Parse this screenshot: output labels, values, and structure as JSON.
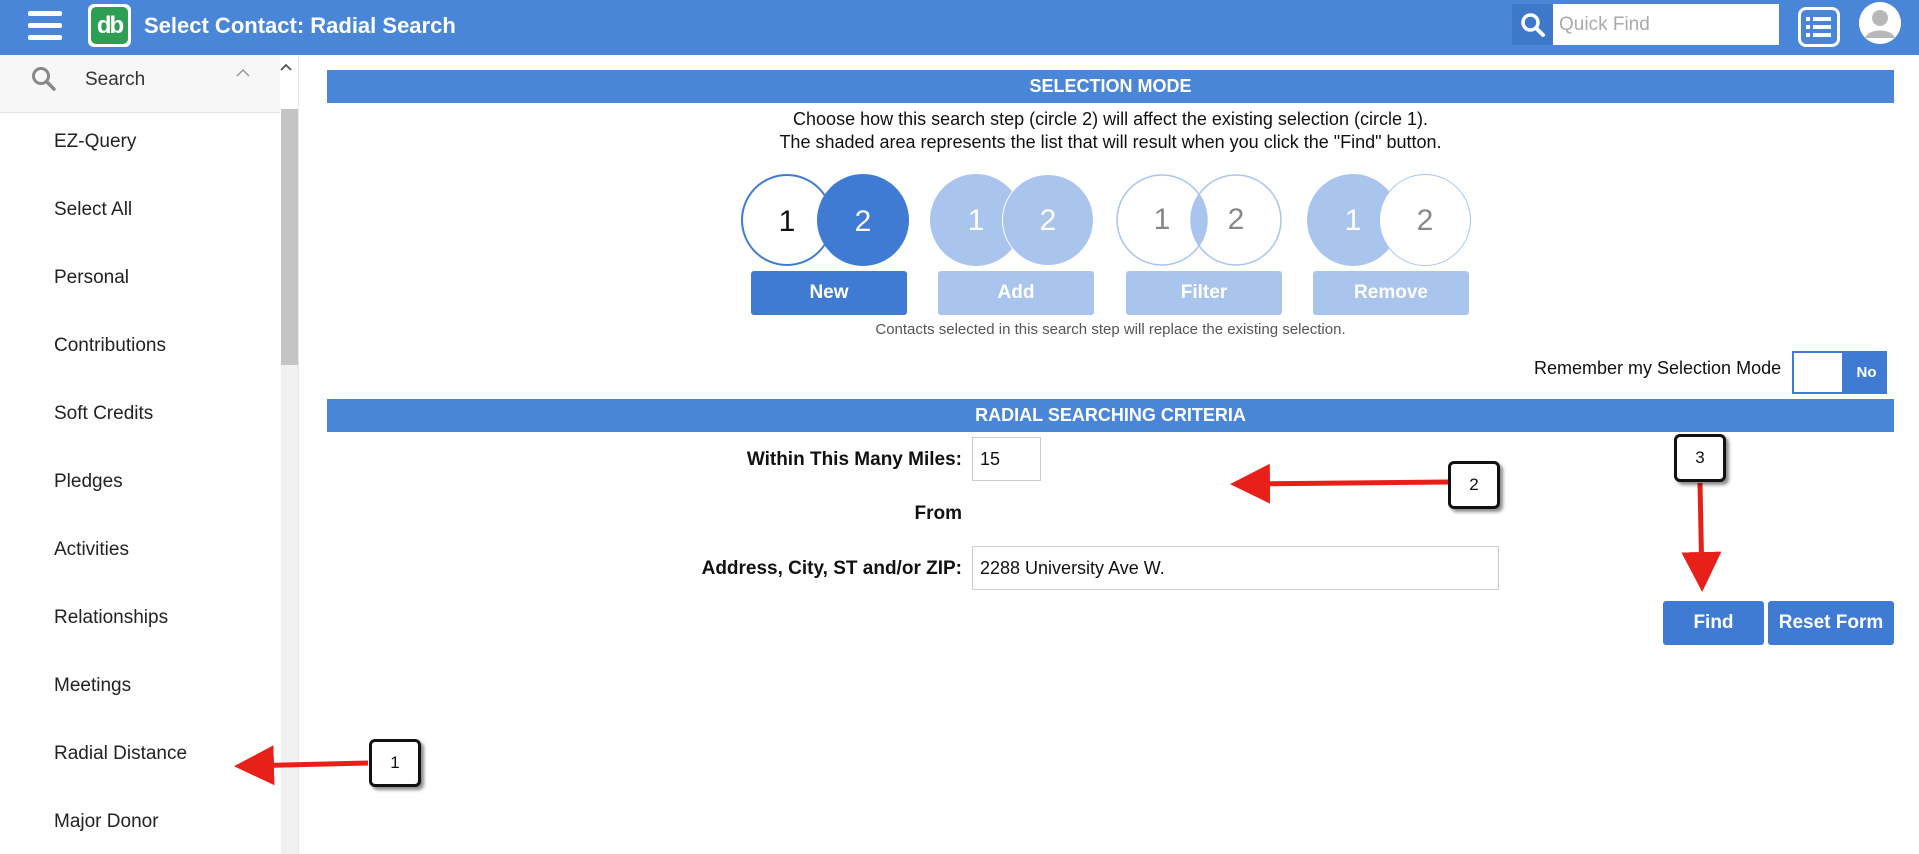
{
  "header": {
    "title": "Select Contact: Radial Search",
    "logo_text": "db",
    "quick_find_placeholder": "Quick Find"
  },
  "sidebar": {
    "search_label": "Search",
    "items": [
      {
        "label": "EZ-Query"
      },
      {
        "label": "Select All"
      },
      {
        "label": "Personal"
      },
      {
        "label": "Contributions"
      },
      {
        "label": "Soft Credits"
      },
      {
        "label": "Pledges"
      },
      {
        "label": "Activities"
      },
      {
        "label": "Relationships"
      },
      {
        "label": "Meetings"
      },
      {
        "label": "Radial Distance"
      },
      {
        "label": "Major Donor"
      }
    ]
  },
  "selection_mode": {
    "header": "SELECTION MODE",
    "instruction_line1": "Choose how this search step (circle 2) will affect the existing selection (circle 1).",
    "instruction_line2": "The shaded area represents the list that will result when you click the \"Find\" button.",
    "circle_1": "1",
    "circle_2": "2",
    "buttons": {
      "new": "New",
      "add": "Add",
      "filter": "Filter",
      "remove": "Remove"
    },
    "active_mode": "New",
    "description": "Contacts selected in this search step will replace the existing selection.",
    "remember_label": "Remember my Selection Mode",
    "remember_toggle": "No"
  },
  "criteria": {
    "header": "RADIAL SEARCHING CRITERIA",
    "miles_label": "Within This Many Miles:",
    "miles_value": "15",
    "from_label": "From",
    "address_label": "Address, City, ST and/or ZIP:",
    "address_value": "2288 University Ave W."
  },
  "actions": {
    "find": "Find",
    "reset": "Reset Form"
  },
  "annotations": {
    "callout_1": "1",
    "callout_2": "2",
    "callout_3": "3"
  },
  "colors": {
    "brand_blue": "#4a86d8",
    "active_blue": "#3f7bd3",
    "inactive_blue": "#a9c5ed",
    "logo_green": "#2f9e55",
    "arrow_red": "#e8201a"
  }
}
